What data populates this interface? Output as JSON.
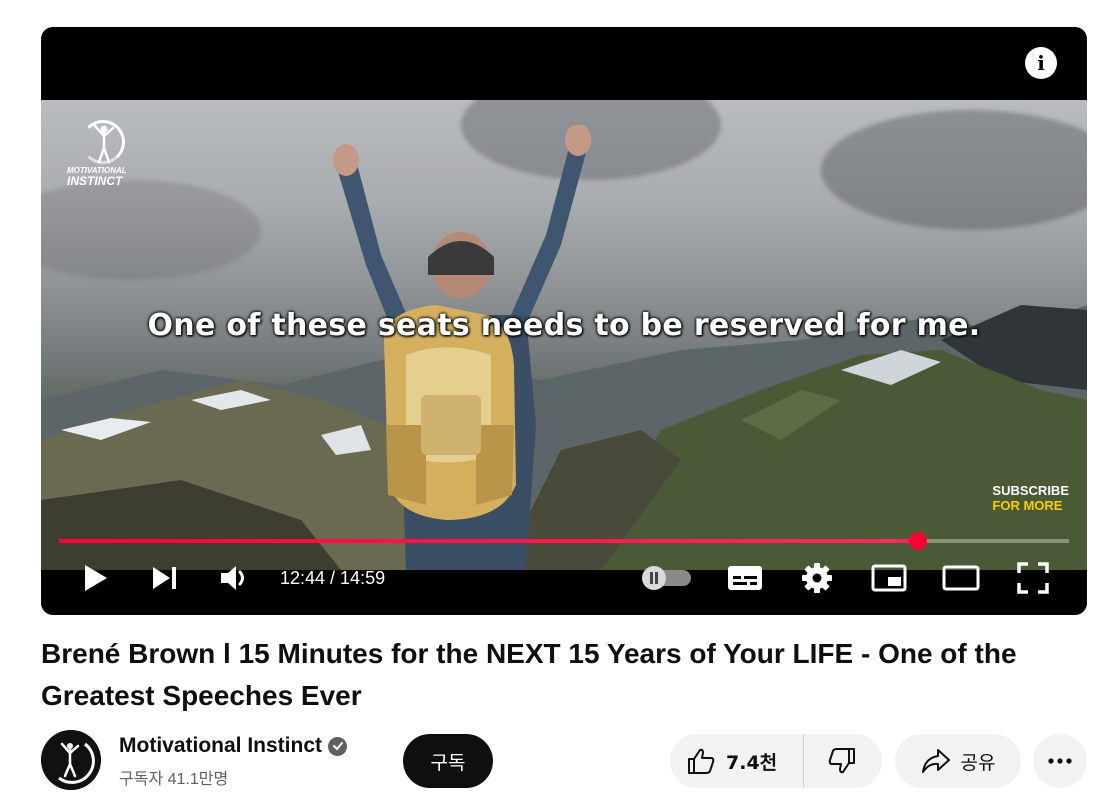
{
  "player": {
    "caption": "One of these seats needs to be reserved for me.",
    "brand_logo_line1": "MOTIVATIONAL",
    "brand_logo_line2": "INSTINCT",
    "subscribe_line1": "SUBSCRIBE",
    "subscribe_line2": "FOR MORE",
    "info_label": "i",
    "time_display": "12:44 / 14:59",
    "progress_fraction": 0.85,
    "autoplay_on": false,
    "accent_color": "#ff0033"
  },
  "video": {
    "title": "Brené Brown l 15 Minutes for the NEXT 15 Years of Your LIFE - One of the Greatest Speeches Ever"
  },
  "channel": {
    "name": "Motivational Instinct",
    "subscribers": "구독자 41.1만명",
    "subscribe_label": "구독"
  },
  "actions": {
    "like_count": "7.4천",
    "share_label": "공유"
  },
  "icons": [
    "play-icon",
    "next-icon",
    "volume-icon",
    "autoplay-toggle-icon",
    "captions-icon",
    "settings-gear-icon",
    "miniplayer-icon",
    "theater-mode-icon",
    "fullscreen-icon",
    "info-icon",
    "verified-check-icon",
    "thumbs-up-icon",
    "thumbs-down-icon",
    "share-arrow-icon",
    "more-dots-icon"
  ]
}
